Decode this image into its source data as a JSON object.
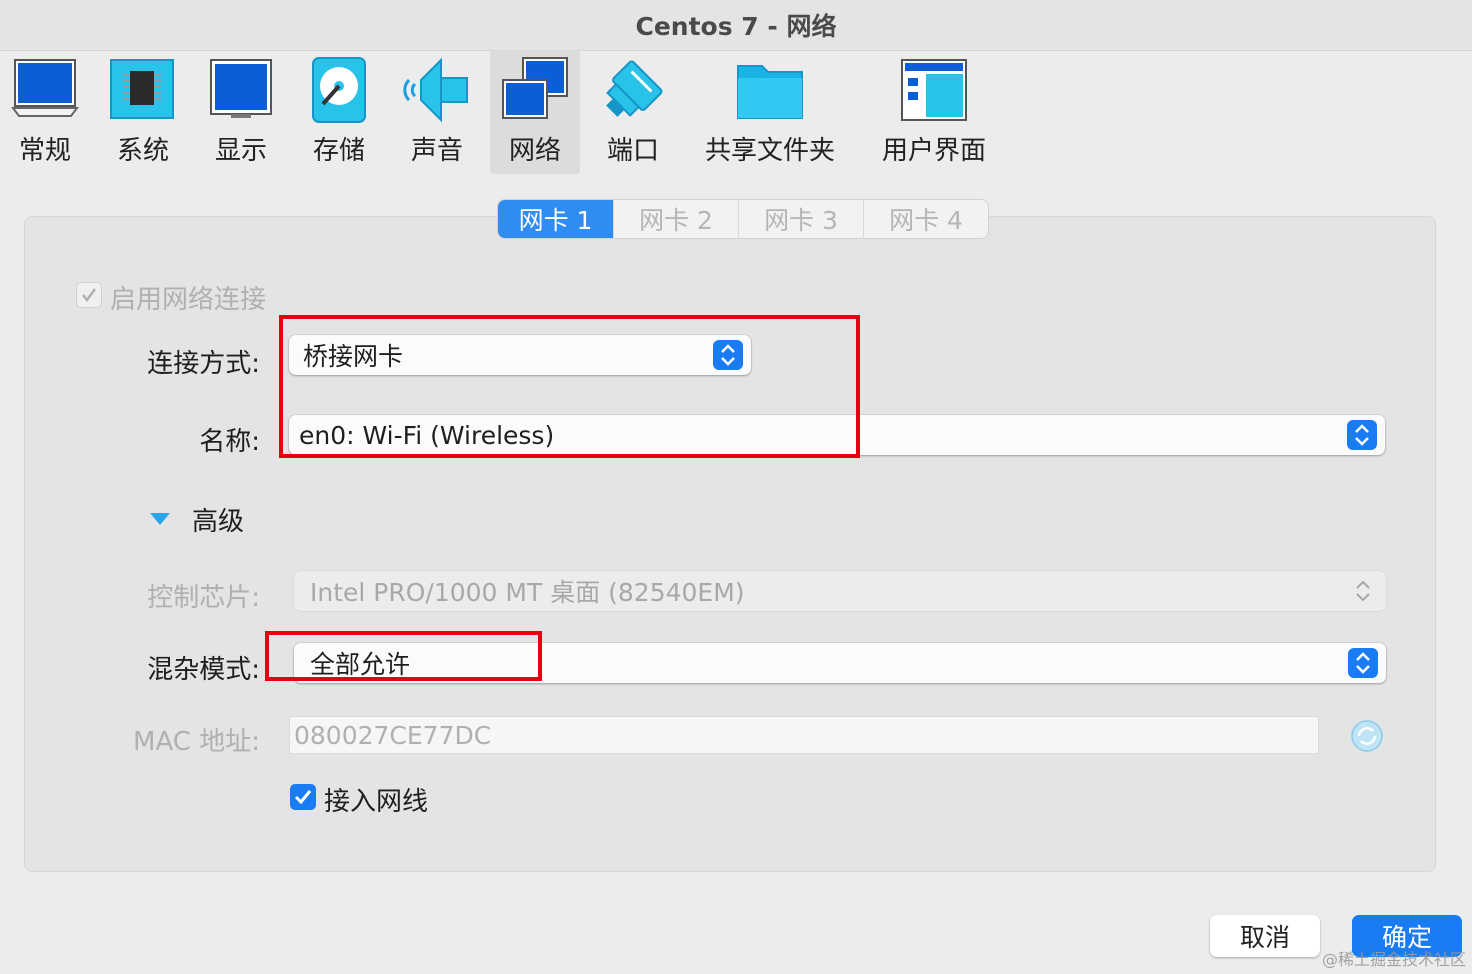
{
  "window": {
    "title": "Centos 7 - 网络"
  },
  "toolbar": {
    "items": [
      {
        "label": "常规",
        "icon": "general-icon"
      },
      {
        "label": "系统",
        "icon": "system-chip-icon"
      },
      {
        "label": "显示",
        "icon": "display-monitor-icon"
      },
      {
        "label": "存储",
        "icon": "storage-disk-icon"
      },
      {
        "label": "声音",
        "icon": "audio-speaker-icon"
      },
      {
        "label": "网络",
        "icon": "network-icon",
        "selected": true
      },
      {
        "label": "端口",
        "icon": "ports-icon"
      },
      {
        "label": "共享文件夹",
        "icon": "shared-folder-icon"
      },
      {
        "label": "用户界面",
        "icon": "user-interface-icon"
      }
    ]
  },
  "tabs": [
    {
      "label": "网卡 1",
      "active": true
    },
    {
      "label": "网卡 2",
      "active": false
    },
    {
      "label": "网卡 3",
      "active": false
    },
    {
      "label": "网卡 4",
      "active": false
    }
  ],
  "form": {
    "enable_label": "启用网络连接",
    "enable_checked": true,
    "attached_label": "连接方式:",
    "attached_value": "桥接网卡",
    "name_label": "名称:",
    "name_value": "en0: Wi-Fi (Wireless)",
    "advanced_label": "高级",
    "adapter_label": "控制芯片:",
    "adapter_value": "Intel PRO/1000 MT 桌面 (82540EM)",
    "promisc_label": "混杂模式:",
    "promisc_value": "全部允许",
    "mac_label": "MAC 地址:",
    "mac_value": "080027CE77DC",
    "cable_label": "接入网线",
    "cable_checked": true
  },
  "buttons": {
    "cancel": "取消",
    "ok": "确定"
  },
  "watermark": "@稀土掘金技术社区",
  "colors": {
    "accent": "#1a7cf2",
    "highlight_box": "#e60012"
  }
}
